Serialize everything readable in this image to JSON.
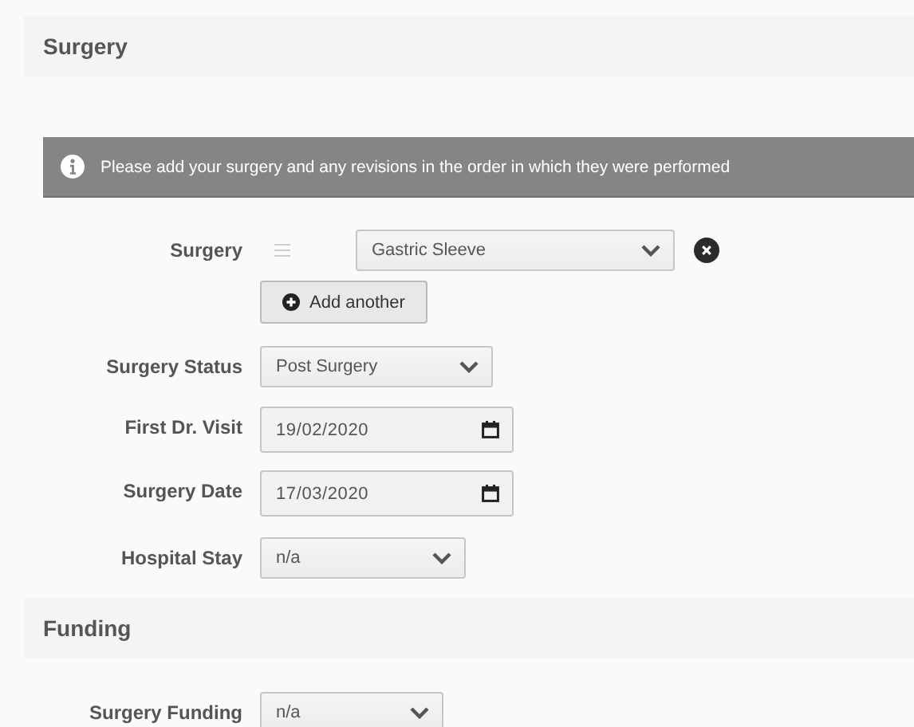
{
  "sections": [
    {
      "title": "Surgery",
      "notice": "Please add your surgery and any revisions in the order in which they were performed",
      "fields": [
        {
          "kind": "surgery_list",
          "label": "Surgery",
          "items": [
            {
              "value": "Gastric Sleeve"
            }
          ],
          "add_button": "Add another"
        },
        {
          "kind": "select",
          "label": "Surgery Status",
          "value": "Post Surgery"
        },
        {
          "kind": "date",
          "label": "First Dr. Visit",
          "value": "19/02/2020"
        },
        {
          "kind": "date",
          "label": "Surgery Date",
          "value": "17/03/2020"
        },
        {
          "kind": "select",
          "label": "Hospital Stay",
          "value": "n/a"
        }
      ]
    },
    {
      "title": "Funding",
      "fields": [
        {
          "kind": "select",
          "label": "Surgery Funding",
          "value": "n/a"
        }
      ]
    }
  ]
}
